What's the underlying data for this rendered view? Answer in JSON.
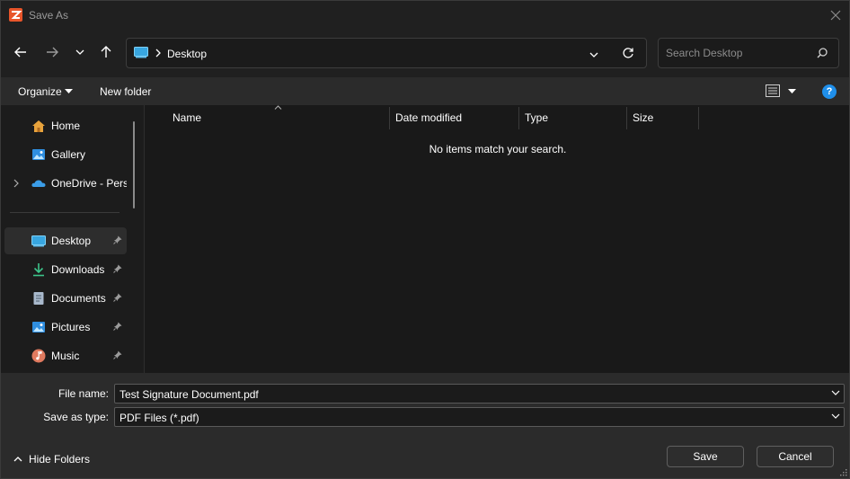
{
  "window": {
    "title": "Save As"
  },
  "address": {
    "location": "Desktop"
  },
  "search": {
    "placeholder": "Search Desktop"
  },
  "commandbar": {
    "organize_label": "Organize",
    "new_folder_label": "New folder",
    "help_label": "?"
  },
  "sidebar": {
    "items": [
      {
        "label": "Home",
        "icon": "home-icon"
      },
      {
        "label": "Gallery",
        "icon": "gallery-icon"
      },
      {
        "label": "OneDrive - Personal",
        "icon": "onedrive-icon"
      },
      {
        "label": "Desktop",
        "icon": "desktop-icon",
        "pinned": true,
        "selected": true
      },
      {
        "label": "Downloads",
        "icon": "downloads-icon",
        "pinned": true
      },
      {
        "label": "Documents",
        "icon": "documents-icon",
        "pinned": true
      },
      {
        "label": "Pictures",
        "icon": "pictures-icon",
        "pinned": true
      },
      {
        "label": "Music",
        "icon": "music-icon",
        "pinned": true
      }
    ]
  },
  "content": {
    "columns": [
      "Name",
      "Date modified",
      "Type",
      "Size"
    ],
    "empty_message": "No items match your search."
  },
  "form": {
    "file_name_label": "File name:",
    "file_name_value": "Test Signature Document.pdf",
    "save_as_type_label": "Save as type:",
    "save_as_type_value": "PDF Files (*.pdf)"
  },
  "footer": {
    "hide_folders_label": "Hide Folders",
    "save_label": "Save",
    "cancel_label": "Cancel"
  },
  "colors": {
    "accent": "#1f8fea",
    "app_icon": "#e8552a",
    "window_bg": "#202020",
    "content_bg": "#191919"
  }
}
